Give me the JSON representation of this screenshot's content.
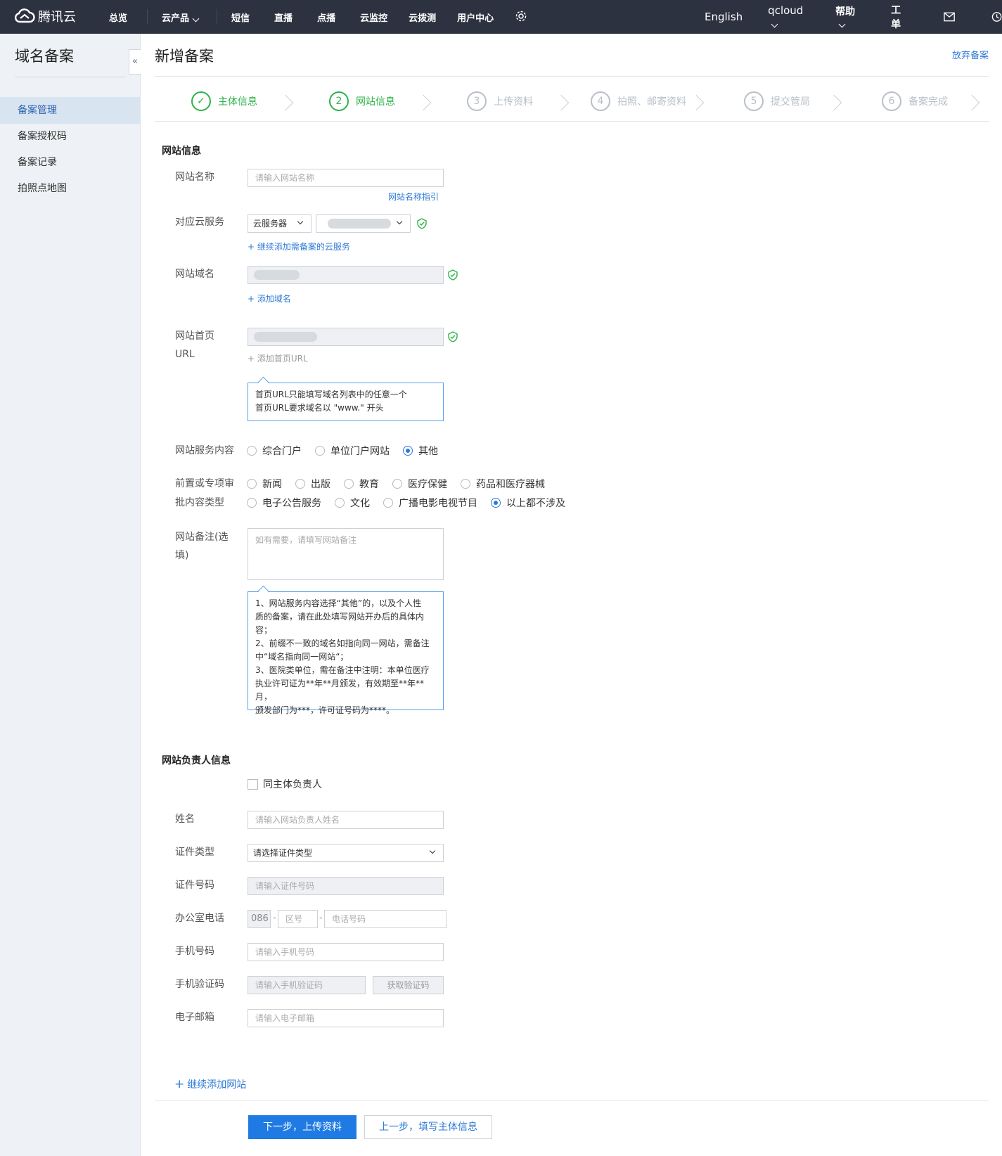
{
  "topbar": {
    "brand": "腾讯云",
    "nav": [
      "总览",
      "云产品",
      "短信",
      "直播",
      "点播",
      "云监控",
      "云拨测",
      "用户中心"
    ],
    "right": {
      "lang": "English",
      "account": "qcloud",
      "help": "帮助",
      "ticket": "工单"
    }
  },
  "sidebar": {
    "title": "域名备案",
    "collapse": "«",
    "items": [
      "备案管理",
      "备案授权码",
      "备案记录",
      "拍照点地图"
    ],
    "active": 0
  },
  "page": {
    "title": "新增备案",
    "abandon": "放弃备案"
  },
  "steps": [
    {
      "num": "✓",
      "label": "主体信息",
      "state": "done"
    },
    {
      "num": "2",
      "label": "网站信息",
      "state": "current"
    },
    {
      "num": "3",
      "label": "上传资料",
      "state": "todo"
    },
    {
      "num": "4",
      "label": "拍照、邮寄资料",
      "state": "todo"
    },
    {
      "num": "5",
      "label": "提交管局",
      "state": "todo"
    },
    {
      "num": "6",
      "label": "备案完成",
      "state": "todo"
    }
  ],
  "site": {
    "section": "网站信息",
    "name_label": "网站名称",
    "name_placeholder": "请输入网站名称",
    "name_guide": "网站名称指引",
    "cloud_label": "对应云服务",
    "cloud_type": "云服务器",
    "cloud_add": "+ 继续添加需备案的云服务",
    "domain_label": "网站域名",
    "domain_add": "+ 添加域名",
    "url_label_1": "网站首页",
    "url_label_2": "URL",
    "url_add": "+ 添加首页URL",
    "url_tip_1": "首页URL只能填写域名列表中的任意一个",
    "url_tip_2": "首页URL要求域名以 \"www.\" 开头",
    "service_label": "网站服务内容",
    "service_opts": [
      "综合门户",
      "单位门户网站",
      "其他"
    ],
    "service_selected": 2,
    "pre_label_1": "前置或专项审",
    "pre_label_2": "批内容类型",
    "pre_row1": [
      "新闻",
      "出版",
      "教育",
      "医疗保健",
      "药品和医疗器械"
    ],
    "pre_row2": [
      "电子公告服务",
      "文化",
      "广播电影电视节目",
      "以上都不涉及"
    ],
    "pre_selected": "以上都不涉及",
    "remark_label_1": "网站备注(选",
    "remark_label_2": "填)",
    "remark_placeholder": "如有需要，请填写网站备注",
    "remark_tip": [
      "1、网站服务内容选择“其他”的，以及个人性",
      "质的备案，请在此处填写网站开办后的具体内",
      "容；",
      "2、前缀不一致的域名如指向同一网站，需备注",
      "中“域名指向同一网站“；",
      "3、医院类单位，需在备注中注明：本单位医疗",
      "执业许可证为**年**月颁发，有效期至**年**月，",
      "颁发部门为***，许可证号码为****。"
    ]
  },
  "owner": {
    "section": "网站负责人信息",
    "same": "同主体负责人",
    "name_label": "姓名",
    "name_placeholder": "请输入网站负责人姓名",
    "idtype_label": "证件类型",
    "idtype_value": "请选择证件类型",
    "idno_label": "证件号码",
    "idno_placeholder": "请输入证件号码",
    "office_label": "办公室电话",
    "office_code": "086",
    "office_area": "区号",
    "office_phone": "电话号码",
    "mobile_label": "手机号码",
    "mobile_placeholder": "请输入手机号码",
    "vcode_label": "手机验证码",
    "vcode_placeholder": "请输入手机验证码",
    "vcode_btn": "获取验证码",
    "email_label": "电子邮箱",
    "email_placeholder": "请输入电子邮箱"
  },
  "footer": {
    "add_site": "继续添加网站",
    "next": "下一步，上传资料",
    "prev": "上一步，填写主体信息"
  }
}
